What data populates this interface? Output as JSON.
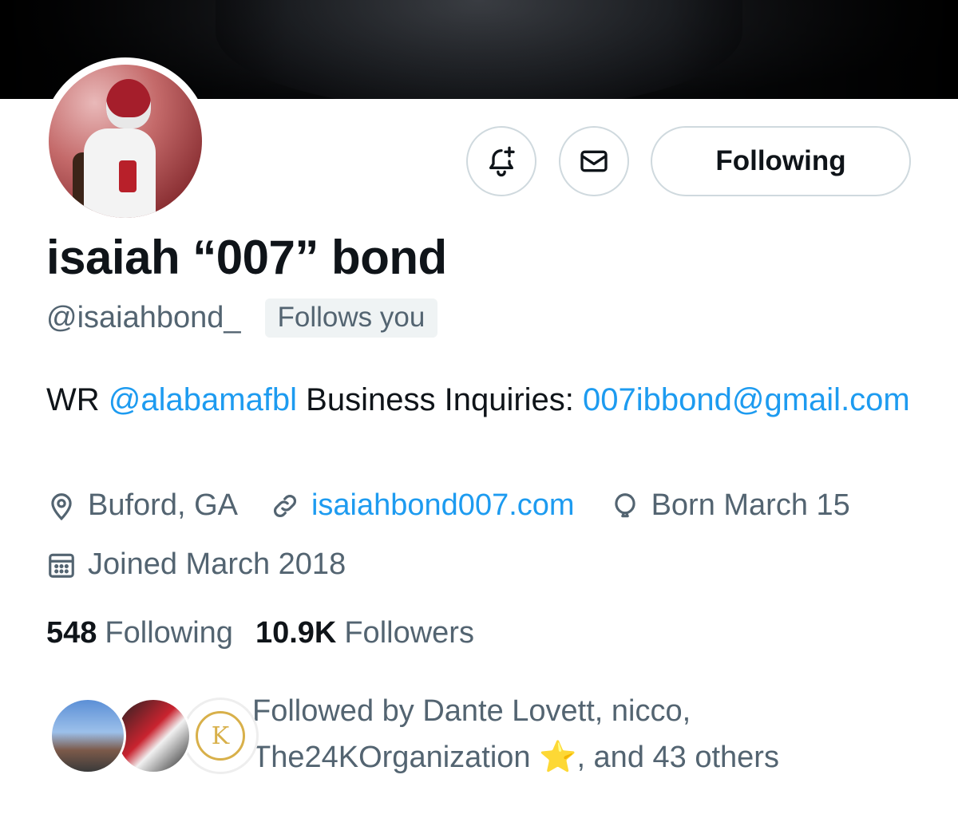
{
  "profile": {
    "name": "isaiah “007” bond",
    "handle": "@isaiahbond_",
    "follows_you_badge": "Follows you",
    "bio": {
      "prefix": "WR ",
      "mention": "@alabamafbl",
      "middle": " Business Inquiries: ",
      "email": "007ibbond@gmail.com"
    },
    "location": "Buford, GA",
    "website": "isaiahbond007.com",
    "birthday": "Born March 15",
    "joined": "Joined March 2018"
  },
  "actions": {
    "follow_label": "Following",
    "notify_icon": "bell-plus-icon",
    "message_icon": "envelope-icon"
  },
  "stats": {
    "following_count": "548",
    "following_label": "Following",
    "followers_count": "10.9K",
    "followers_label": "Followers"
  },
  "followed_by": {
    "prefix": "Followed by Dante Lovett, nicco, The24KOrganization ",
    "emoji": "⭐",
    "suffix": ", and 43 others",
    "avatar3_letter": "K"
  },
  "colors": {
    "link": "#1d9bf0",
    "secondary_text": "#536471",
    "primary_text": "#0f1419",
    "border": "#cfd9de"
  }
}
